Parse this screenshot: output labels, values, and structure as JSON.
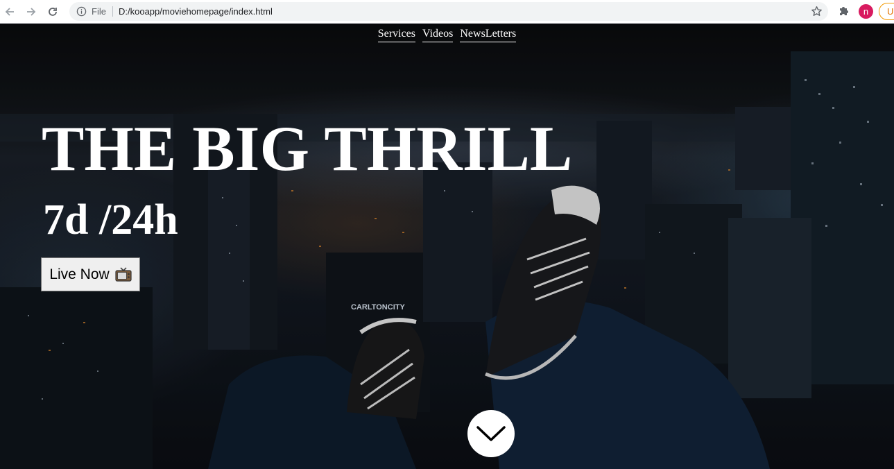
{
  "browser": {
    "scheme_label": "File",
    "url": "D:/kooapp/moviehomepage/index.html",
    "profile_initial": "n",
    "update_label": "U",
    "profile_color": "#d81b60",
    "update_color": "#e37400"
  },
  "nav": {
    "items": [
      {
        "label": "Services"
      },
      {
        "label": "Videos"
      },
      {
        "label": "NewsLetters"
      }
    ]
  },
  "hero": {
    "title": "THE BIG THRILL",
    "subtitle": "7d /24h",
    "cta_label": "Live Now",
    "cta_icon": "television-icon",
    "scroll_icon": "chevron-down-icon"
  }
}
